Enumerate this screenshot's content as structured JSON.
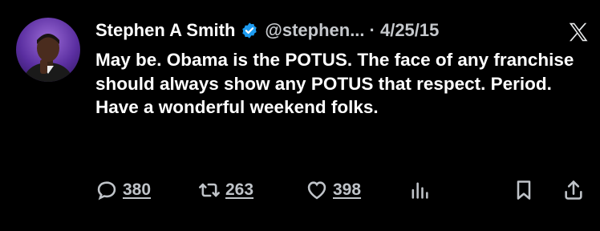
{
  "author": {
    "name": "Stephen A Smith",
    "handle": "@stephen...",
    "date": "· 4/25/15",
    "verified_color": "#1d9bf0"
  },
  "tweet": {
    "text": "May be. Obama is the POTUS. The face of any franchise should always show any POTUS that respect. Period. Have a wonderful weekend folks."
  },
  "actions": {
    "replies": "380",
    "retweets": "263",
    "likes": "398"
  },
  "icons": [
    "reply-icon",
    "retweet-icon",
    "heart-icon",
    "views-icon",
    "bookmark-icon",
    "share-icon",
    "x-logo-icon",
    "verified-badge-icon"
  ]
}
